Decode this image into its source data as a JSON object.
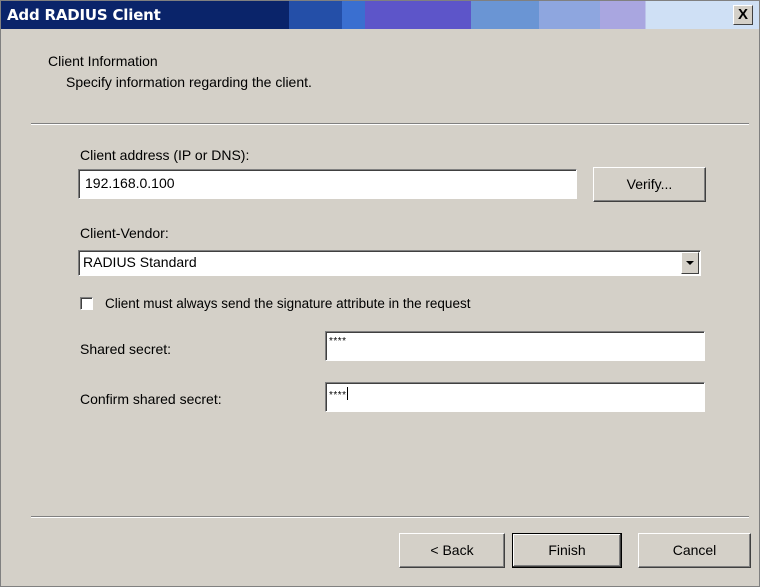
{
  "dialog": {
    "title": "Add RADIUS Client",
    "close_glyph": "X",
    "header_title": "Client Information",
    "header_subtitle": "Specify information regarding the client."
  },
  "form": {
    "client_address_label": "Client address (IP or DNS):",
    "client_address_value": "192.168.0.100",
    "verify_button": "Verify...",
    "vendor_label": "Client-Vendor:",
    "vendor_value": "RADIUS Standard",
    "signature_checkbox_label": "Client must always send the signature attribute in the request",
    "signature_checked": false,
    "shared_secret_label": "Shared secret:",
    "shared_secret_value": "****",
    "confirm_secret_label": "Confirm shared secret:",
    "confirm_secret_value": "****"
  },
  "footer": {
    "back_button": "< Back",
    "finish_button": "Finish",
    "cancel_button": "Cancel"
  },
  "icons": {
    "close": "close-icon",
    "dropdown": "chevron-down-icon"
  }
}
